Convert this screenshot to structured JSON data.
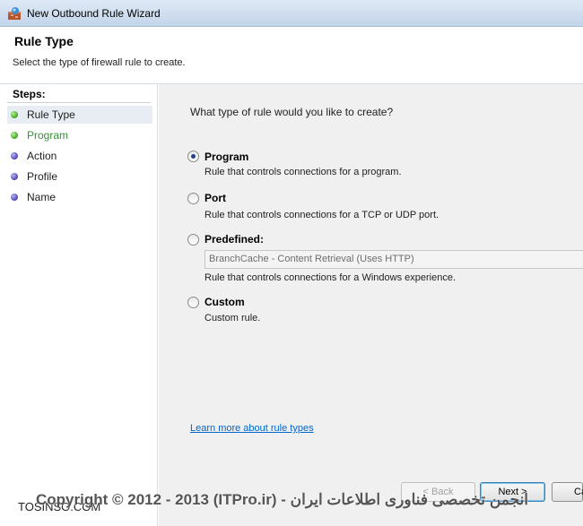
{
  "window": {
    "title": "New Outbound Rule Wizard"
  },
  "header": {
    "title": "Rule Type",
    "description": "Select the type of firewall rule to create."
  },
  "steps": {
    "heading": "Steps:",
    "items": [
      {
        "label": "Rule Type",
        "status": "green"
      },
      {
        "label": "Program",
        "status": "green"
      },
      {
        "label": "Action",
        "status": "purple"
      },
      {
        "label": "Profile",
        "status": "purple"
      },
      {
        "label": "Name",
        "status": "purple"
      }
    ]
  },
  "main": {
    "question": "What type of rule would you like to create?",
    "options": [
      {
        "label": "Program",
        "description": "Rule that controls connections for a program.",
        "selected": true
      },
      {
        "label": "Port",
        "description": "Rule that controls connections for a TCP or UDP port.",
        "selected": false
      },
      {
        "label": "Predefined:",
        "description": "Rule that controls connections for a Windows experience.",
        "selected": false
      },
      {
        "label": "Custom",
        "description": "Custom rule.",
        "selected": false
      }
    ],
    "predefined_select_value": "BranchCache - Content Retrieval (Uses HTTP)",
    "learn_more_link": "Learn more about rule types"
  },
  "buttons": {
    "back": "< Back",
    "next": "Next >",
    "cancel": "Ca"
  },
  "watermark": {
    "text": "Copyright © 2012 - 2013 (ITPro.ir) - انجمن تخصصی فناوری اطلاعات ایران",
    "left_text": "TOSINSO.COM"
  },
  "colors": {
    "step_done": "#3fa51f",
    "step_pending": "#4b45b5",
    "link": "#0066cc"
  }
}
